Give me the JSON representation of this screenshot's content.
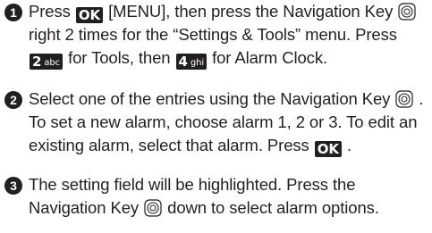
{
  "steps": [
    {
      "number": "1",
      "line1_a": "Press",
      "ok_key": "OK",
      "line1_b": "[MENU], then press the Navigation Key",
      "line2": "right 2 times for the “Settings & Tools” menu. Press",
      "key2_num": "2",
      "key2_sub": "abc",
      "line3_a": "for Tools, then",
      "key4_num": "4",
      "key4_sub": "ghi",
      "line3_b": "for Alarm Clock."
    },
    {
      "number": "2",
      "line1_a": "Select one of the entries using the Navigation Key",
      "line1_b": ".",
      "line2": "To set a new alarm, choose alarm 1, 2 or 3. To edit an",
      "line3_a": "existing alarm, select that alarm. Press",
      "ok_key": "OK",
      "line3_b": "."
    },
    {
      "number": "3",
      "line1": "The setting field will be highlighted. Press the",
      "line2_a": "Navigation Key",
      "line2_b": "down to select alarm options."
    }
  ],
  "icons": {
    "navigation_key": "navigation-key-icon"
  }
}
